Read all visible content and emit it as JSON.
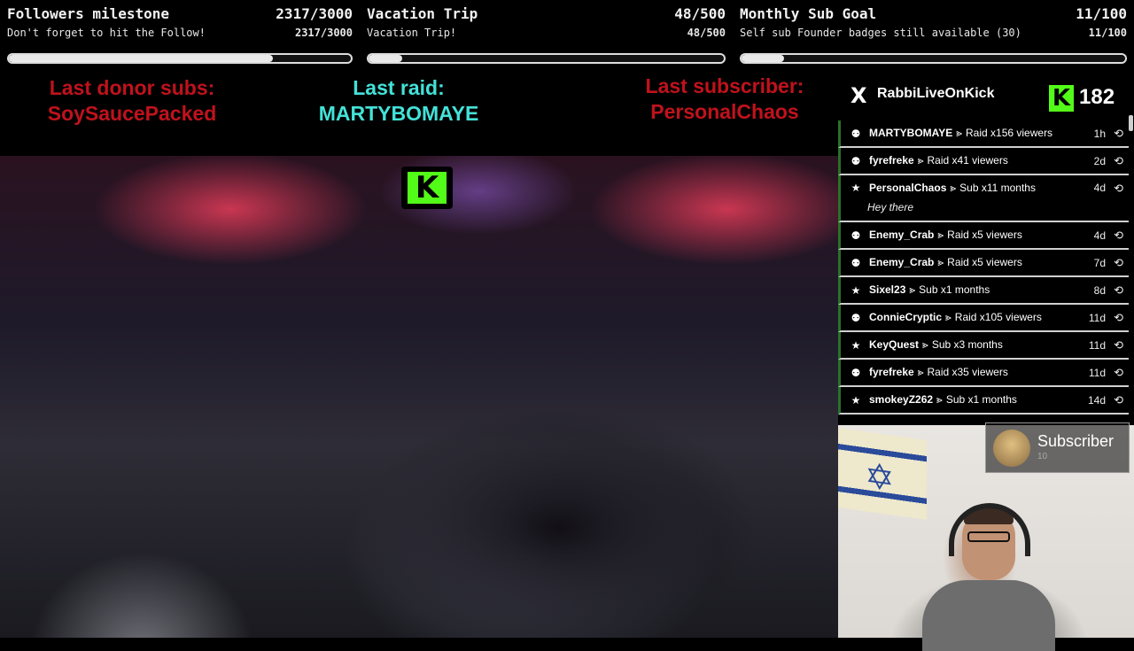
{
  "goals": [
    {
      "title": "Followers milestone",
      "count": "2317/3000",
      "subtitle": "Don't forget to hit the Follow!",
      "subcount": "2317/3000",
      "progress": 0.772
    },
    {
      "title": "Vacation Trip",
      "count": "48/500",
      "subtitle": "Vacation Trip!",
      "subcount": "48/500",
      "progress": 0.096
    },
    {
      "title": "Monthly Sub Goal",
      "count": "11/100",
      "subtitle": "Self sub Founder badges still available (30)",
      "subcount": "11/100",
      "progress": 0.11
    }
  ],
  "last": {
    "donor_label": "Last donor subs:",
    "donor_name": "SoySaucePacked",
    "raid_label": "Last raid:",
    "raid_name": "MARTYBOMAYE",
    "sub_label": "Last subscriber:",
    "sub_name": "PersonalChaos"
  },
  "colors": {
    "red": "#c0121c",
    "cyan": "#43e2d8",
    "kick_green": "#53fc18"
  },
  "video": {
    "kick_badge": "K"
  },
  "kick": {
    "x_icon": "X",
    "name": "RabbiLiveOnKick",
    "logo": "K",
    "count": "182"
  },
  "events": [
    {
      "icon": "raid-icon",
      "glyph": "⚉",
      "name": "MARTYBOMAYE",
      "action": "Raid x156 viewers",
      "time": "1h"
    },
    {
      "icon": "raid-icon",
      "glyph": "⚉",
      "name": "fyrefreke",
      "action": "Raid x41 viewers",
      "time": "2d"
    },
    {
      "icon": "star-icon",
      "glyph": "★",
      "name": "PersonalChaos",
      "action": "Sub x11 months",
      "time": "4d",
      "message": "Hey there"
    },
    {
      "icon": "raid-icon",
      "glyph": "⚉",
      "name": "Enemy_Crab",
      "action": "Raid x5 viewers",
      "time": "4d"
    },
    {
      "icon": "raid-icon",
      "glyph": "⚉",
      "name": "Enemy_Crab",
      "action": "Raid x5 viewers",
      "time": "7d"
    },
    {
      "icon": "star-icon",
      "glyph": "★",
      "name": "Sixel23",
      "action": "Sub x1 months",
      "time": "8d"
    },
    {
      "icon": "raid-icon",
      "glyph": "⚉",
      "name": "ConnieCryptic",
      "action": "Raid x105 viewers",
      "time": "11d"
    },
    {
      "icon": "star-icon",
      "glyph": "★",
      "name": "KeyQuest",
      "action": "Sub x3 months",
      "time": "11d"
    },
    {
      "icon": "raid-icon",
      "glyph": "⚉",
      "name": "fyrefreke",
      "action": "Raid x35 viewers",
      "time": "11d"
    },
    {
      "icon": "star-icon",
      "glyph": "★",
      "name": "smokeyZ262",
      "action": "Sub x1 months",
      "time": "14d"
    }
  ],
  "arrow": "⪢",
  "replay": "⟲",
  "sub_alert": {
    "title": "Subscriber",
    "count": "10"
  }
}
